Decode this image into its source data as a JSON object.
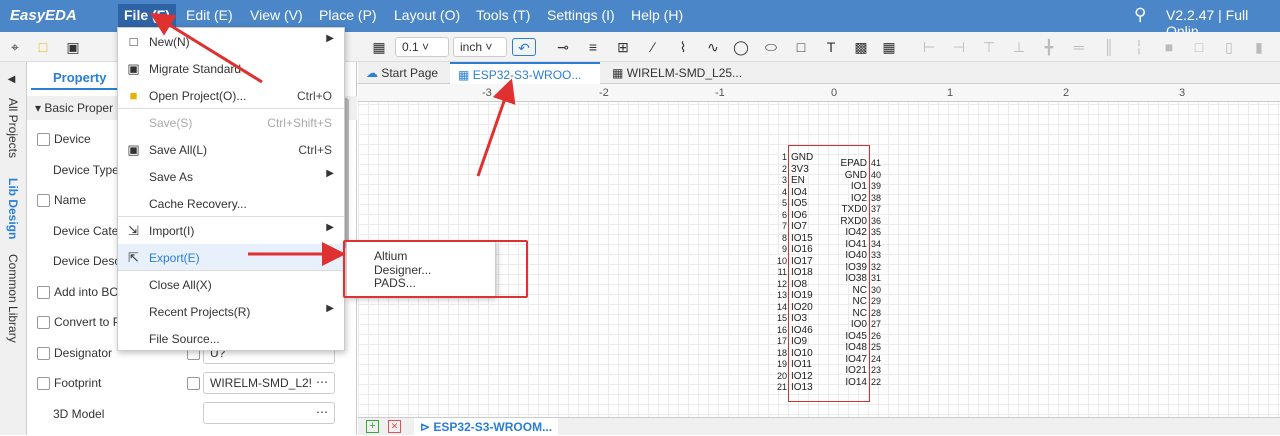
{
  "app": {
    "logo": "EasyEDA",
    "version": "V2.2.47 | Full Onlin"
  },
  "menubar": {
    "file": "File (F)",
    "edit": "Edit (E)",
    "view": "View (V)",
    "place": "Place (P)",
    "layout": "Layout (O)",
    "tools": "Tools (T)",
    "settings": "Settings (I)",
    "help": "Help (H)"
  },
  "toolbar": {
    "grid": "0.1",
    "unit": "inch"
  },
  "lefttabs": {
    "all_projects": "All Projects",
    "lib_design": "Lib Design",
    "common_library": "Common Library"
  },
  "panel": {
    "tab": "Property",
    "section": "Basic Proper",
    "rows": {
      "device": "Device",
      "device_type": "Device Type",
      "name": "Name",
      "device_cate": "Device Cate",
      "device_desc": "Device Desc",
      "add_bom": "Add into BO",
      "convert": "Convert to P",
      "designator": "Designator",
      "footprint": "Footprint",
      "model3d": "3D Model"
    },
    "designator_value": "U?",
    "footprint_value": "WIRELM-SMD_L2!",
    "more": "⋯"
  },
  "doctabs": {
    "start": "Start Page",
    "esp": "ESP32-S3-WROO...",
    "wirelm": "WIRELM-SMD_L25..."
  },
  "ruler": {
    "labels": [
      "-3",
      "-2",
      "-1",
      "0",
      "1",
      "2",
      "3"
    ]
  },
  "bottombar": {
    "sheet": "ESP32-S3-WROOM..."
  },
  "filemenu": {
    "new": "New(N)",
    "migrate": "Migrate Standard",
    "open": "Open Project(O)...",
    "open_sc": "Ctrl+O",
    "save": "Save(S)",
    "save_sc": "Ctrl+Shift+S",
    "saveall": "Save All(L)",
    "saveall_sc": "Ctrl+S",
    "saveas": "Save As",
    "cache": "Cache Recovery...",
    "import": "Import(I)",
    "export": "Export(E)",
    "closeall": "Close All(X)",
    "recent": "Recent Projects(R)",
    "filesource": "File Source..."
  },
  "submenu": {
    "altium": "Altium Designer...",
    "pads": "PADS..."
  },
  "symbol": {
    "left_pins": [
      "GND",
      "3V3",
      "EN",
      "IO4",
      "IO5",
      "IO6",
      "IO7",
      "IO15",
      "IO16",
      "IO17",
      "IO18",
      "IO8",
      "IO19",
      "IO20",
      "IO3",
      "IO46",
      "IO9",
      "IO10",
      "IO11",
      "IO12",
      "IO13"
    ],
    "left_nums": [
      "1",
      "2",
      "3",
      "4",
      "5",
      "6",
      "7",
      "8",
      "9",
      "10",
      "11",
      "12",
      "13",
      "14",
      "15",
      "16",
      "17",
      "18",
      "19",
      "20",
      "21"
    ],
    "right_pins": [
      "EPAD",
      "GND",
      "IO1",
      "IO2",
      "TXD0",
      "RXD0",
      "IO42",
      "IO41",
      "IO40",
      "IO39",
      "IO38",
      "NC",
      "NC",
      "NC",
      "IO0",
      "IO45",
      "IO48",
      "IO47",
      "IO21",
      "IO14"
    ],
    "right_nums": [
      "41",
      "40",
      "39",
      "38",
      "37",
      "36",
      "35",
      "34",
      "33",
      "32",
      "31",
      "30",
      "29",
      "28",
      "27",
      "26",
      "25",
      "24",
      "23",
      "22"
    ]
  },
  "colors": {
    "menubar": "#4a86c8",
    "annotation": "#e03131",
    "accent": "#2a7fd4"
  }
}
